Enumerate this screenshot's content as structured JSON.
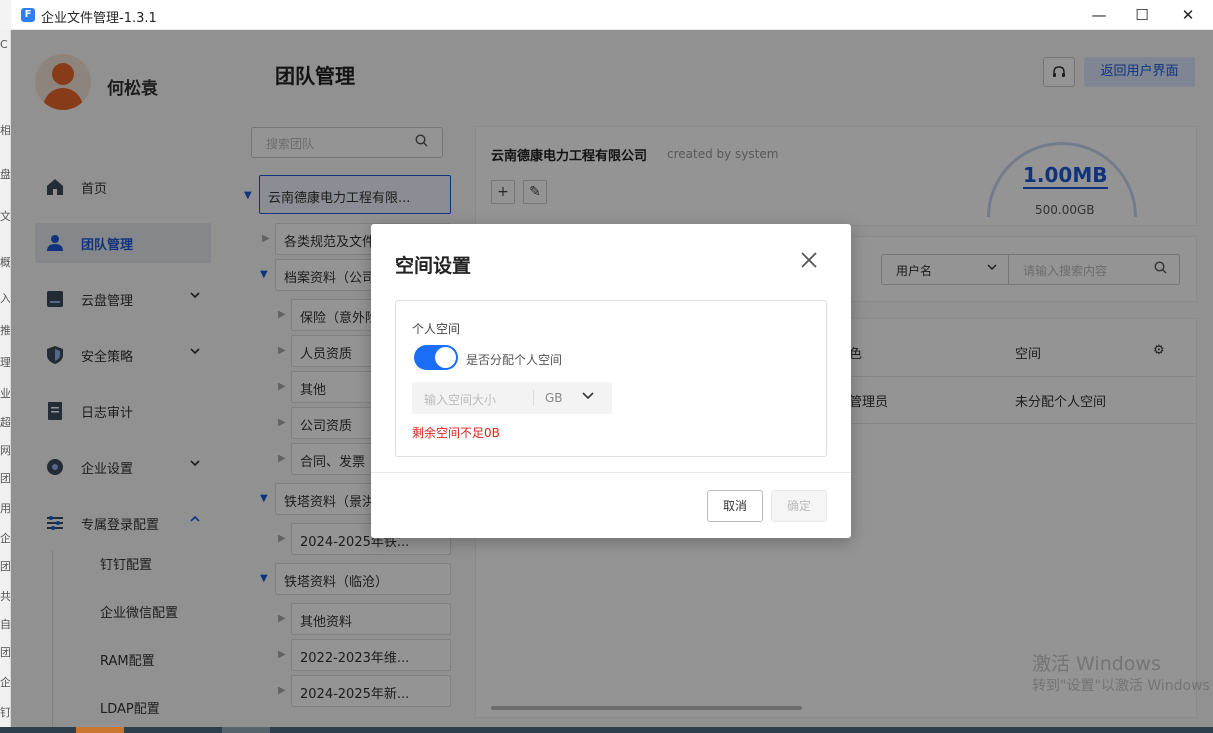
{
  "window": {
    "title": "企业文件管理-1.3.1",
    "app_icon_letter": "F",
    "minimize": "—",
    "maximize": "☐",
    "close": "✕"
  },
  "gutter_fragments": [
    "C",
    "相",
    "盘",
    "文中",
    "概",
    "入",
    "推",
    "理",
    "业",
    "超",
    "网",
    "团",
    "用",
    "企",
    "团",
    "共",
    "自",
    "团",
    "企",
    "钉"
  ],
  "user": {
    "name": "何松袁"
  },
  "sidebar": {
    "items": [
      {
        "label": "首页",
        "icon": "home-icon"
      },
      {
        "label": "团队管理",
        "icon": "team-icon",
        "active": true
      },
      {
        "label": "云盘管理",
        "icon": "cloud-drive-icon",
        "expandable": true
      },
      {
        "label": "安全策略",
        "icon": "shield-icon",
        "expandable": true
      },
      {
        "label": "日志审计",
        "icon": "log-icon"
      },
      {
        "label": "企业设置",
        "icon": "gear-icon",
        "expandable": true
      },
      {
        "label": "专属登录配置",
        "icon": "sliders-icon",
        "expanded": true
      }
    ],
    "sub_items": [
      "钉钉配置",
      "企业微信配置",
      "RAM配置",
      "LDAP配置"
    ],
    "chevron_down": "⌄",
    "chevron_up": "⌃"
  },
  "header": {
    "title": "团队管理",
    "support_icon": "headset-icon",
    "back_button": "返回用户界面"
  },
  "tree": {
    "search_placeholder": "搜索团队",
    "nodes": [
      {
        "label": "云南德康电力工程有限...",
        "selected": true
      },
      {
        "label": "各类规范及文件"
      },
      {
        "label": "档案资料（公司）"
      },
      {
        "label": "保险（意外险）"
      },
      {
        "label": "人员资质"
      },
      {
        "label": "其他"
      },
      {
        "label": "公司资质"
      },
      {
        "label": "合同、发票"
      },
      {
        "label": "铁塔资料（景洪）"
      },
      {
        "label": "2024-2025年铁..."
      },
      {
        "label": "铁塔资料（临沧）"
      },
      {
        "label": "其他资料"
      },
      {
        "label": "2022-2023年维..."
      },
      {
        "label": "2024-2025年新..."
      }
    ]
  },
  "main": {
    "company_name": "云南德康电力工程有限公司",
    "created_by": "created by system",
    "add_icon": "+",
    "edit_icon": "✎",
    "storage_used": "1.00MB",
    "storage_total": "500.00GB",
    "search_field": "用户名",
    "search_placeholder": "请输入搜索内容",
    "table": {
      "headers": [
        "色",
        "空间"
      ],
      "row": [
        "管理员",
        "未分配个人空间"
      ]
    },
    "settings_icon": "⚙"
  },
  "watermark": {
    "line1": "激活 Windows",
    "line2": "转到\"设置\"以激活 Windows"
  },
  "modal": {
    "title": "空间设置",
    "section_label": "个人空间",
    "toggle_label": "是否分配个人空间",
    "toggle_on": true,
    "size_placeholder": "输入空间大小",
    "unit": "GB",
    "error": "剩余空间不足0B",
    "cancel": "取消",
    "confirm": "确定"
  }
}
